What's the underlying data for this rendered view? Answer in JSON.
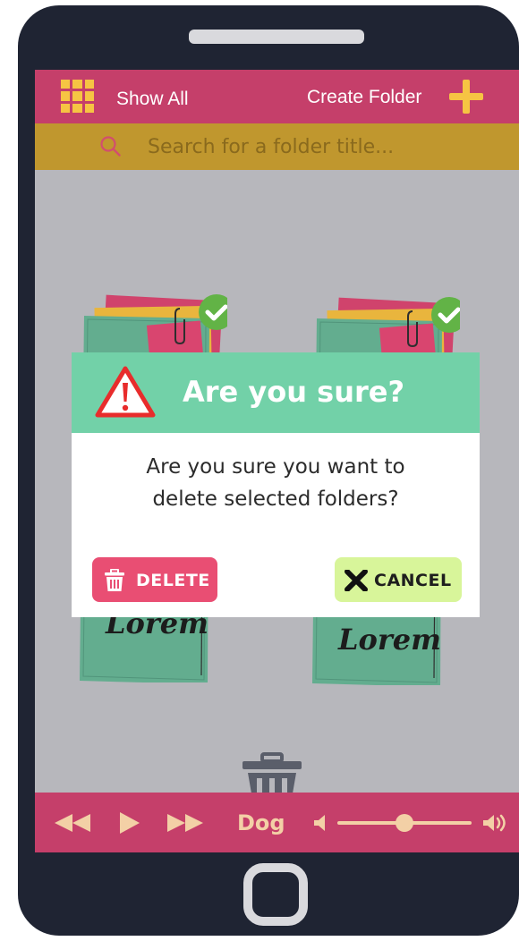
{
  "header": {
    "show_all_label": "Show All",
    "create_folder_label": "Create Folder",
    "grid_icon": "grid-icon",
    "plus_icon": "plus-icon"
  },
  "search": {
    "placeholder": "Search for a folder title...",
    "icon": "search-icon"
  },
  "folders": [
    {
      "label": "Lorem",
      "selected": true
    },
    {
      "label": "Lorem",
      "selected": true
    }
  ],
  "dialog": {
    "title": "Are you sure?",
    "message_line1": "Are you sure you want to",
    "message_line2": "delete selected folders?",
    "delete_label": "DELETE",
    "cancel_label": "CANCEL",
    "warning_icon": "warning-icon"
  },
  "player": {
    "track": "Dog",
    "volume_fraction": 0.5,
    "icons": [
      "rewind-icon",
      "play-icon",
      "fast-forward-icon",
      "volume-low-icon",
      "volume-high-icon"
    ]
  },
  "colors": {
    "accent": "#c53f6a",
    "search_bar": "#c0972e",
    "dialog_header": "#72d1a8",
    "delete_button": "#e94e73",
    "cancel_button": "#d8f59a",
    "icon_yellow": "#f6c443",
    "phone_body": "#1f2433"
  }
}
